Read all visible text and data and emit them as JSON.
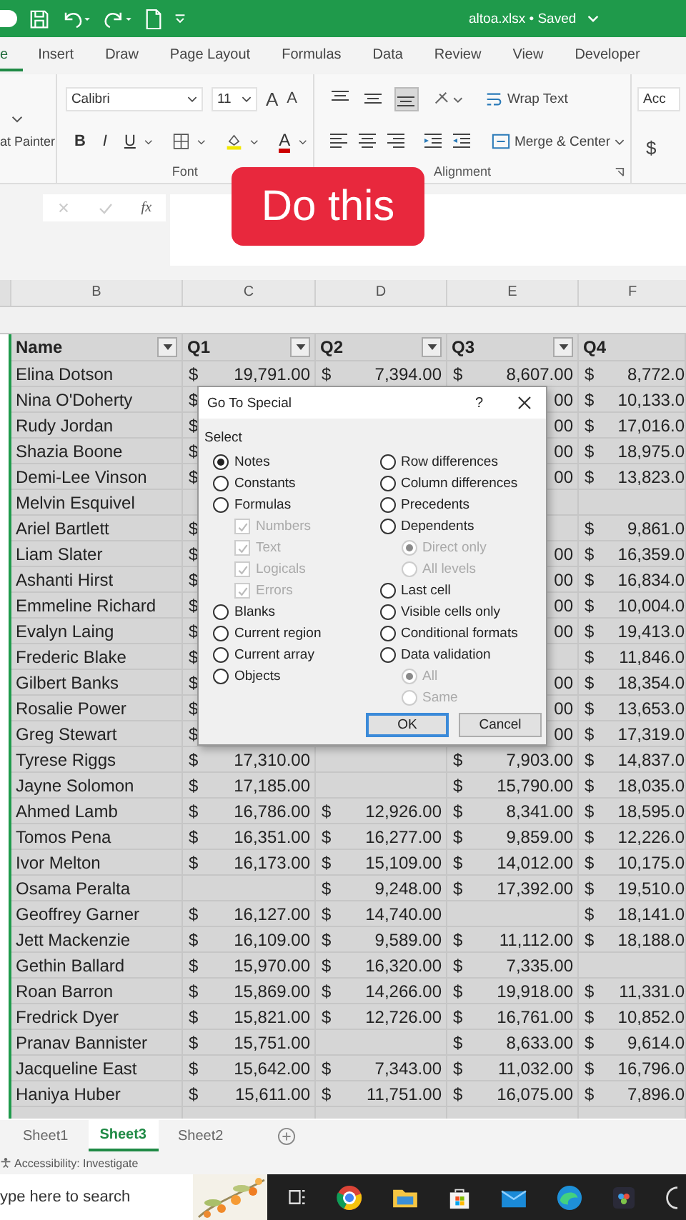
{
  "title_bar": {
    "title": "altoa.xlsx • Saved"
  },
  "ribbon_tabs": [
    {
      "label": "e",
      "selected": true
    },
    {
      "label": "Insert",
      "selected": false
    },
    {
      "label": "Draw",
      "selected": false
    },
    {
      "label": "Page Layout",
      "selected": false
    },
    {
      "label": "Formulas",
      "selected": false
    },
    {
      "label": "Data",
      "selected": false
    },
    {
      "label": "Review",
      "selected": false
    },
    {
      "label": "View",
      "selected": false
    },
    {
      "label": "Developer",
      "selected": false
    }
  ],
  "ribbon": {
    "clipboard": {
      "format_painter": "at Painter"
    },
    "font": {
      "font_name": "Calibri",
      "font_size": "11",
      "grow": "A",
      "shrink": "A",
      "bold": "B",
      "italic": "I",
      "underline": "U",
      "font_color": "A",
      "label": "Font"
    },
    "alignment": {
      "vertical_align": [
        {
          "selected": false
        },
        {
          "selected": false
        },
        {
          "selected": true
        }
      ],
      "wrap_text": "Wrap Text",
      "merge_center": "Merge & Center",
      "label": "Alignment"
    },
    "number": {
      "format": "Acc",
      "currency": "$"
    }
  },
  "formula_bar": {
    "function_label": "fx"
  },
  "overlay_button": "Do this",
  "column_letters": [
    "B",
    "C",
    "D",
    "E",
    "F"
  ],
  "table": {
    "headers": [
      {
        "label": "Name",
        "filter": true
      },
      {
        "label": "Q1",
        "filter": true
      },
      {
        "label": "Q2",
        "filter": true
      },
      {
        "label": "Q3",
        "filter": true
      },
      {
        "label": "Q4",
        "filter": false
      }
    ],
    "rows": [
      {
        "name": "Elina Dotson",
        "q1": {
          "symbol": "$",
          "amount": "19,791.00"
        },
        "q2": {
          "symbol": "$",
          "amount": "7,394.00"
        },
        "q3": {
          "symbol": "$",
          "amount": "8,607.00"
        },
        "q4": {
          "symbol": "$",
          "amount": "8,772.0"
        }
      },
      {
        "name": "Nina O'Doherty",
        "q1": {
          "symbol": "$"
        },
        "q3": {
          "amount": "00"
        },
        "q4": {
          "symbol": "$",
          "amount": "10,133.0"
        }
      },
      {
        "name": "Rudy Jordan",
        "q1": {
          "symbol": "$"
        },
        "q3": {
          "amount": "00"
        },
        "q4": {
          "symbol": "$",
          "amount": "17,016.0"
        }
      },
      {
        "name": "Shazia Boone",
        "q1": {
          "symbol": "$"
        },
        "q3": {
          "amount": "00"
        },
        "q4": {
          "symbol": "$",
          "amount": "18,975.0"
        }
      },
      {
        "name": "Demi-Lee Vinson",
        "q1": {
          "symbol": "$"
        },
        "q3": {
          "amount": "00"
        },
        "q4": {
          "symbol": "$",
          "amount": "13,823.0"
        }
      },
      {
        "name": "Melvin Esquivel"
      },
      {
        "name": "Ariel Bartlett",
        "q1": {
          "symbol": "$"
        },
        "q4": {
          "symbol": "$",
          "amount": "9,861.0"
        }
      },
      {
        "name": "Liam Slater",
        "q1": {
          "symbol": "$"
        },
        "q3": {
          "amount": "00"
        },
        "q4": {
          "symbol": "$",
          "amount": "16,359.0"
        }
      },
      {
        "name": "Ashanti Hirst",
        "q1": {
          "symbol": "$"
        },
        "q3": {
          "amount": "00"
        },
        "q4": {
          "symbol": "$",
          "amount": "16,834.0"
        }
      },
      {
        "name": "Emmeline Richard",
        "q1": {
          "symbol": "$"
        },
        "q3": {
          "amount": "00"
        },
        "q4": {
          "symbol": "$",
          "amount": "10,004.0"
        }
      },
      {
        "name": "Evalyn Laing",
        "q1": {
          "symbol": "$"
        },
        "q3": {
          "amount": "00"
        },
        "q4": {
          "symbol": "$",
          "amount": "19,413.0"
        }
      },
      {
        "name": "Frederic Blake",
        "q1": {
          "symbol": "$"
        },
        "q4": {
          "symbol": "$",
          "amount": "11,846.0"
        }
      },
      {
        "name": "Gilbert Banks",
        "q1": {
          "symbol": "$"
        },
        "q3": {
          "amount": "00"
        },
        "q4": {
          "symbol": "$",
          "amount": "18,354.0"
        }
      },
      {
        "name": "Rosalie Power",
        "q1": {
          "symbol": "$"
        },
        "q3": {
          "amount": "00"
        },
        "q4": {
          "symbol": "$",
          "amount": "13,653.0"
        }
      },
      {
        "name": "Greg Stewart",
        "q1": {
          "symbol": "$"
        },
        "q3": {
          "amount": "00"
        },
        "q4": {
          "symbol": "$",
          "amount": "17,319.0"
        }
      },
      {
        "name": "Tyrese Riggs",
        "q1": {
          "symbol": "$",
          "amount": "17,310.00"
        },
        "q3": {
          "symbol": "$",
          "amount": "7,903.00"
        },
        "q4": {
          "symbol": "$",
          "amount": "14,837.0"
        }
      },
      {
        "name": "Jayne Solomon",
        "q1": {
          "symbol": "$",
          "amount": "17,185.00"
        },
        "q3": {
          "symbol": "$",
          "amount": "15,790.00"
        },
        "q4": {
          "symbol": "$",
          "amount": "18,035.0"
        }
      },
      {
        "name": "Ahmed Lamb",
        "q1": {
          "symbol": "$",
          "amount": "16,786.00"
        },
        "q2": {
          "symbol": "$",
          "amount": "12,926.00"
        },
        "q3": {
          "symbol": "$",
          "amount": "8,341.00"
        },
        "q4": {
          "symbol": "$",
          "amount": "18,595.0"
        }
      },
      {
        "name": "Tomos Pena",
        "q1": {
          "symbol": "$",
          "amount": "16,351.00"
        },
        "q2": {
          "symbol": "$",
          "amount": "16,277.00"
        },
        "q3": {
          "symbol": "$",
          "amount": "9,859.00"
        },
        "q4": {
          "symbol": "$",
          "amount": "12,226.0"
        }
      },
      {
        "name": "Ivor Melton",
        "q1": {
          "symbol": "$",
          "amount": "16,173.00"
        },
        "q2": {
          "symbol": "$",
          "amount": "15,109.00"
        },
        "q3": {
          "symbol": "$",
          "amount": "14,012.00"
        },
        "q4": {
          "symbol": "$",
          "amount": "10,175.0"
        }
      },
      {
        "name": "Osama Peralta",
        "q2": {
          "symbol": "$",
          "amount": "9,248.00"
        },
        "q3": {
          "symbol": "$",
          "amount": "17,392.00"
        },
        "q4": {
          "symbol": "$",
          "amount": "19,510.0"
        }
      },
      {
        "name": "Geoffrey Garner",
        "q1": {
          "symbol": "$",
          "amount": "16,127.00"
        },
        "q2": {
          "symbol": "$",
          "amount": "14,740.00"
        },
        "q4": {
          "symbol": "$",
          "amount": "18,141.0"
        }
      },
      {
        "name": "Jett Mackenzie",
        "q1": {
          "symbol": "$",
          "amount": "16,109.00"
        },
        "q2": {
          "symbol": "$",
          "amount": "9,589.00"
        },
        "q3": {
          "symbol": "$",
          "amount": "11,112.00"
        },
        "q4": {
          "symbol": "$",
          "amount": "18,188.0"
        }
      },
      {
        "name": "Gethin Ballard",
        "q1": {
          "symbol": "$",
          "amount": "15,970.00"
        },
        "q2": {
          "symbol": "$",
          "amount": "16,320.00"
        },
        "q3": {
          "symbol": "$",
          "amount": "7,335.00"
        }
      },
      {
        "name": "Roan Barron",
        "q1": {
          "symbol": "$",
          "amount": "15,869.00"
        },
        "q2": {
          "symbol": "$",
          "amount": "14,266.00"
        },
        "q3": {
          "symbol": "$",
          "amount": "19,918.00"
        },
        "q4": {
          "symbol": "$",
          "amount": "11,331.0"
        }
      },
      {
        "name": "Fredrick Dyer",
        "q1": {
          "symbol": "$",
          "amount": "15,821.00"
        },
        "q2": {
          "symbol": "$",
          "amount": "12,726.00"
        },
        "q3": {
          "symbol": "$",
          "amount": "16,761.00"
        },
        "q4": {
          "symbol": "$",
          "amount": "10,852.0"
        }
      },
      {
        "name": "Pranav Bannister",
        "q1": {
          "symbol": "$",
          "amount": "15,751.00"
        },
        "q3": {
          "symbol": "$",
          "amount": "8,633.00"
        },
        "q4": {
          "symbol": "$",
          "amount": "9,614.0"
        }
      },
      {
        "name": "Jacqueline East",
        "q1": {
          "symbol": "$",
          "amount": "15,642.00"
        },
        "q2": {
          "symbol": "$",
          "amount": "7,343.00"
        },
        "q3": {
          "symbol": "$",
          "amount": "11,032.00"
        },
        "q4": {
          "symbol": "$",
          "amount": "16,796.0"
        }
      },
      {
        "name": "Haniya Huber",
        "q1": {
          "symbol": "$",
          "amount": "15,611.00"
        },
        "q2": {
          "symbol": "$",
          "amount": "11,751.00"
        },
        "q3": {
          "symbol": "$",
          "amount": "16,075.00"
        },
        "q4": {
          "symbol": "$",
          "amount": "7,896.0"
        }
      }
    ]
  },
  "dialog": {
    "title": "Go To Special",
    "help": "?",
    "section": "Select",
    "left": [
      {
        "kind": "radio",
        "label": "Notes",
        "selected": true,
        "disabled": false
      },
      {
        "kind": "radio",
        "label": "Constants",
        "selected": false,
        "disabled": false
      },
      {
        "kind": "radio",
        "label": "Formulas",
        "selected": false,
        "disabled": false,
        "children": [
          {
            "kind": "checkbox",
            "label": "Numbers",
            "checked": true,
            "disabled": true
          },
          {
            "kind": "checkbox",
            "label": "Text",
            "checked": true,
            "disabled": true
          },
          {
            "kind": "checkbox",
            "label": "Logicals",
            "checked": true,
            "disabled": true
          },
          {
            "kind": "checkbox",
            "label": "Errors",
            "checked": true,
            "disabled": true
          }
        ]
      },
      {
        "kind": "radio",
        "label": "Blanks",
        "selected": false,
        "disabled": false
      },
      {
        "kind": "radio",
        "label": "Current region",
        "selected": false,
        "disabled": false
      },
      {
        "kind": "radio",
        "label": "Current array",
        "selected": false,
        "disabled": false
      },
      {
        "kind": "radio",
        "label": "Objects",
        "selected": false,
        "disabled": false
      }
    ],
    "right": [
      {
        "kind": "radio",
        "label": "Row differences",
        "selected": false,
        "disabled": false
      },
      {
        "kind": "radio",
        "label": "Column differences",
        "selected": false,
        "disabled": false
      },
      {
        "kind": "radio",
        "label": "Precedents",
        "selected": false,
        "disabled": false
      },
      {
        "kind": "radio",
        "label": "Dependents",
        "selected": false,
        "disabled": false,
        "children": [
          {
            "kind": "radio",
            "label": "Direct only",
            "selected": true,
            "disabled": true
          },
          {
            "kind": "radio",
            "label": "All levels",
            "selected": false,
            "disabled": true
          }
        ]
      },
      {
        "kind": "radio",
        "label": "Last cell",
        "selected": false,
        "disabled": false
      },
      {
        "kind": "radio",
        "label": "Visible cells only",
        "selected": false,
        "disabled": false
      },
      {
        "kind": "radio",
        "label": "Conditional formats",
        "selected": false,
        "disabled": false
      },
      {
        "kind": "radio",
        "label": "Data validation",
        "selected": false,
        "disabled": false,
        "children": [
          {
            "kind": "radio",
            "label": "All",
            "selected": true,
            "disabled": true
          },
          {
            "kind": "radio",
            "label": "Same",
            "selected": false,
            "disabled": true
          }
        ]
      }
    ],
    "buttons": [
      {
        "label": "OK",
        "default": true
      },
      {
        "label": "Cancel",
        "default": false
      }
    ]
  },
  "sheet_tabs": [
    {
      "label": "Sheet1",
      "selected": false
    },
    {
      "label": "Sheet3",
      "selected": true
    },
    {
      "label": "Sheet2",
      "selected": false
    }
  ],
  "status_bar": "Accessibility: Investigate",
  "taskbar": {
    "search_placeholder": "ype here to search"
  }
}
